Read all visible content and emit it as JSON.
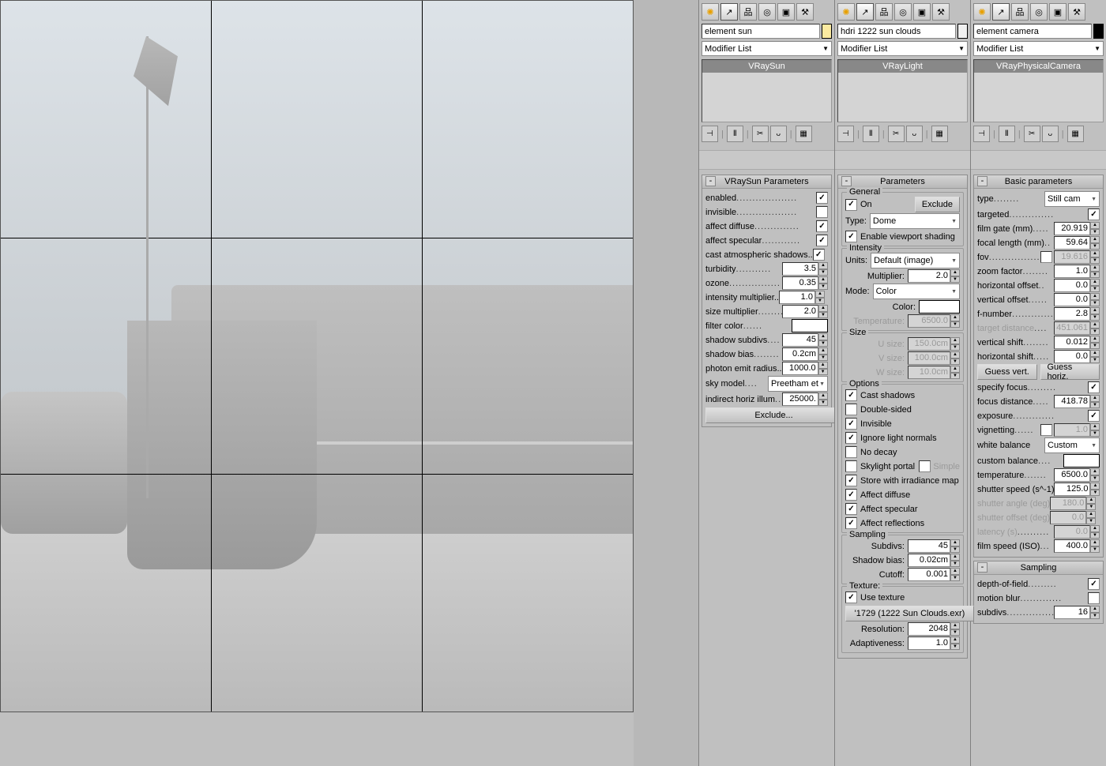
{
  "panel1": {
    "name": "element sun",
    "modifier": "Modifier List",
    "stack": "VRaySun",
    "rollout": "VRaySun Parameters",
    "p": {
      "enabled": "enabled",
      "invisible": "invisible",
      "affect_diffuse": "affect diffuse",
      "affect_specular": "affect specular",
      "cast_atm": "cast atmospheric shadows..",
      "turbidity": "turbidity",
      "turbidity_v": "3.5",
      "ozone": "ozone",
      "ozone_v": "0.35",
      "intensity_mult": "intensity multiplier..",
      "intensity_mult_v": "1.0",
      "size_mult": "size multiplier",
      "size_mult_v": "2.0",
      "filter_color": "filter color",
      "shadow_subdivs": "shadow subdivs",
      "shadow_subdivs_v": "45",
      "shadow_bias": "shadow bias",
      "shadow_bias_v": "0.2cm",
      "photon_emit": "photon emit radius..",
      "photon_emit_v": "1000.0",
      "sky_model": "sky model",
      "sky_model_v": "Preetham et",
      "indirect_horiz": "indirect horiz illum",
      "indirect_horiz_v": "25000.",
      "exclude": "Exclude..."
    }
  },
  "panel2": {
    "name": "hdri 1222 sun clouds",
    "modifier": "Modifier List",
    "stack": "VRayLight",
    "rollout": "Parameters",
    "general": {
      "title": "General",
      "on": "On",
      "exclude": "Exclude",
      "type": "Type:",
      "type_v": "Dome",
      "viewport": "Enable viewport shading"
    },
    "intensity": {
      "title": "Intensity",
      "units": "Units:",
      "units_v": "Default (image)",
      "mult": "Multiplier:",
      "mult_v": "2.0",
      "mode": "Mode:",
      "mode_v": "Color",
      "color": "Color:",
      "temp": "Temperature:",
      "temp_v": "6500.0"
    },
    "size": {
      "title": "Size",
      "u": "U size:",
      "u_v": "150.0cm",
      "v": "V size:",
      "v_v": "100.0cm",
      "w": "W size:",
      "w_v": "10.0cm"
    },
    "options": {
      "title": "Options",
      "cast": "Cast shadows",
      "double": "Double-sided",
      "inv": "Invisible",
      "ign": "Ignore light normals",
      "decay": "No decay",
      "sky": "Skylight portal",
      "simple": "Simple",
      "irr": "Store with irradiance map",
      "diff": "Affect diffuse",
      "spec": "Affect specular",
      "refl": "Affect reflections"
    },
    "sampling": {
      "title": "Sampling",
      "subdivs": "Subdivs:",
      "subdivs_v": "45",
      "bias": "Shadow bias:",
      "bias_v": "0.02cm",
      "cutoff": "Cutoff:",
      "cutoff_v": "0.001"
    },
    "texture": {
      "title": "Texture:",
      "use": "Use texture",
      "file": "'1729 (1222 Sun Clouds.exr)",
      "res": "Resolution:",
      "res_v": "2048",
      "adapt": "Adaptiveness:",
      "adapt_v": "1.0"
    }
  },
  "panel3": {
    "name": "element camera",
    "modifier": "Modifier List",
    "stack": "VRayPhysicalCamera",
    "rollout": "Basic parameters",
    "p": {
      "type": "type",
      "type_v": "Still cam",
      "targeted": "targeted",
      "film_gate": "film gate (mm)",
      "film_gate_v": "20.919",
      "focal": "focal length (mm)",
      "focal_v": "59.64",
      "fov": "fov",
      "fov_v": "19.616",
      "zoom": "zoom factor",
      "zoom_v": "1.0",
      "hoff": "horizontal offset",
      "hoff_v": "0.0",
      "voff": "vertical offset",
      "voff_v": "0.0",
      "fnum": "f-number",
      "fnum_v": "2.8",
      "tdist": "target distance",
      "tdist_v": "451.061",
      "vshift": "vertical shift",
      "vshift_v": "0.012",
      "hshift": "horizontal shift",
      "hshift_v": "0.0",
      "gv": "Guess vert.",
      "gh": "Guess horiz.",
      "spec_focus": "specify focus",
      "focus_dist": "focus distance",
      "focus_dist_v": "418.78",
      "exposure": "exposure",
      "vignetting": "vignetting",
      "vignetting_v": "1.0",
      "wb": "white balance",
      "wb_v": "Custom",
      "cbal": "custom balance",
      "temp": "temperature",
      "temp_v": "6500.0",
      "shutter_s": "shutter speed (s^-1)",
      "shutter_s_v": "125.0",
      "shutter_a": "shutter angle (deg)",
      "shutter_a_v": "180.0",
      "shutter_o": "shutter offset (deg)",
      "shutter_o_v": "0.0",
      "latency": "latency (s)",
      "latency_v": "0.0",
      "iso": "film speed (ISO)",
      "iso_v": "400.0"
    },
    "sampling": {
      "title": "Sampling",
      "dof": "depth-of-field",
      "mb": "motion blur",
      "subdivs": "subdivs",
      "subdivs_v": "16"
    }
  }
}
